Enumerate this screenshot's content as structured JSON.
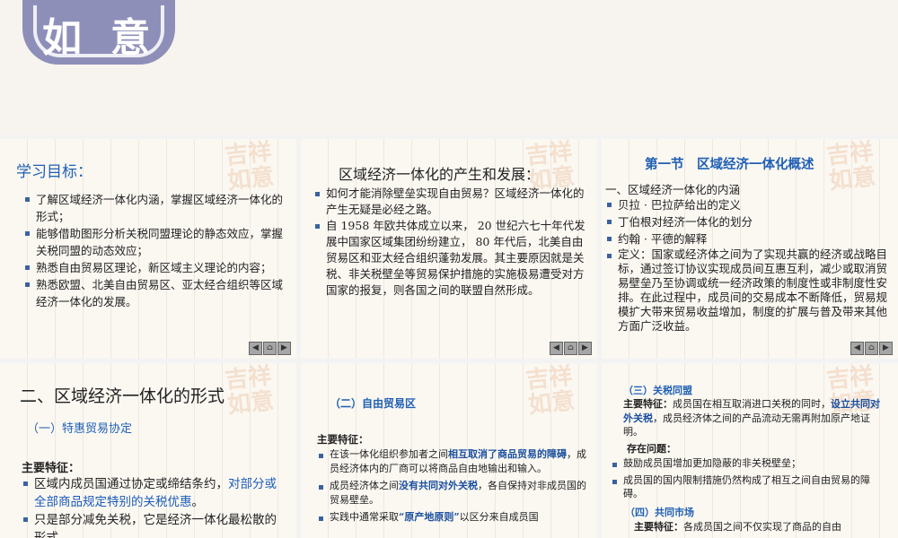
{
  "s1": {
    "title": "学习目标：",
    "items": [
      "了解区域经济一体化内涵，掌握区域经济一体化的形式；",
      "能够借助图形分析关税同盟理论的静态效应，掌握关税同盟的动态效应；",
      "熟悉自由贸易区理论，新区域主义理论的内容；",
      "熟悉欧盟、北美自由贸易区、亚太经合组织等区域经济一体化的发展。"
    ]
  },
  "s2": {
    "title": "区域经济一体化的产生和发展：",
    "items": [
      "如何才能消除壁垒实现自由贸易？区域经济一体化的产生无疑是必经之路。",
      "自 1958 年欧共体成立以来， 20 世纪六七十年代发展中国家区域集团纷纷建立， 80 年代后，北美自由贸易区和亚太经合组织蓬勃发展。其主要原因就是关税、非关税壁垒等贸易保护措施的实施极易遭受对方国家的报复，则各国之间的联盟自然形成。"
    ]
  },
  "s3": {
    "title": "第一节　区域经济一体化概述",
    "sub": "一、区域经济一体化的内涵",
    "items": [
      "贝拉 · 巴拉萨给出的定义",
      "丁伯根对经济一体化的划分",
      "约翰 · 平德的解释",
      "定义：国家或经济体之间为了实现共赢的经济或战略目标，通过签订协议实现成员间互惠互利，减少或取消贸易壁垒乃至协调或统一经济政策的制度性或非制度性安排。在此过程中，成员间的交易成本不断降低，贸易规模扩大带来贸易收益增加，制度的扩展与普及带来其他方面广泛收益。"
    ]
  },
  "s4": {
    "title": "二、区域经济一体化的形式",
    "sub": "（一）特惠贸易协定",
    "heading": "主要特征：",
    "item1_a": "区域内成员国通过协定或缔结条约，",
    "item1_b": "对部分或全部商品规定特别的关税优惠",
    "item1_c": "。",
    "item2": "只是部分减免关税，它是经济一体化最松散的形式。"
  },
  "s5": {
    "title": "（二）自由贸易区",
    "heading": "主要特征：",
    "i1_a": "在该一体化组织参加者之间",
    "i1_b": "相互取消了商品贸易的障碍",
    "i1_c": "，成员经济体内的厂商可以将商品自由地输出和输入。",
    "i2_a": "成员经济体之间",
    "i2_b": "没有共同对外关税",
    "i2_c": "，各自保持对非成员国的贸易壁垒。",
    "i3_a": "实践中通常采取",
    "i3_b": "“原产地原则”",
    "i3_c": "以区分来自成员国"
  },
  "s6": {
    "title": "（三）关税同盟",
    "p1_a": "主要特征：",
    "p1_b": "成员国在相互取消进口关税的同时，",
    "p1_c": "设立共同对外关税",
    "p1_d": "，成员经济体之间的产品流动无需再附加原产地证明。",
    "problems": "存在问题：",
    "items": [
      "鼓励成员国增加更加隐蔽的非关税壁垒；",
      "成员国的国内限制措施仍然构成了相互之间自由贸易的障碍。"
    ],
    "title2": "（四）共同市场",
    "p2_a": "主要特征：",
    "p2_b": "各成员国之间不仅实现了商品的自由"
  },
  "nav": {
    "prev": "◀",
    "home": "⌂",
    "next": "▶"
  },
  "stamp_text": "吉祥如意",
  "logo_text": "如意"
}
